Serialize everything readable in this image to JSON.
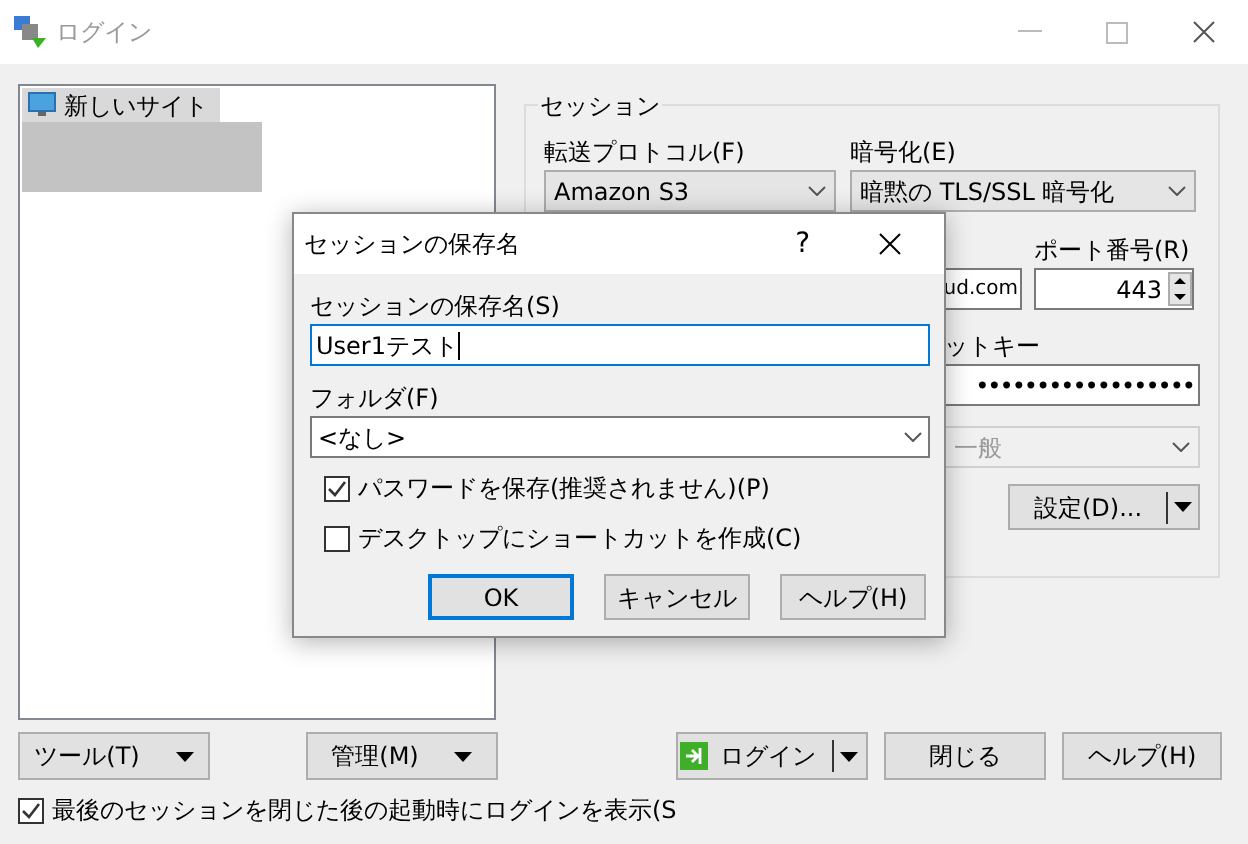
{
  "window": {
    "title": "ログイン"
  },
  "site_tree": {
    "items": [
      {
        "label": "新しいサイト",
        "selected": true
      }
    ]
  },
  "session": {
    "title": "セッション",
    "protocol": {
      "label": "転送プロトコル(F)",
      "value": "Amazon S3"
    },
    "encryption": {
      "label": "暗号化(E)",
      "value": "暗黙の TLS/SSL 暗号化"
    },
    "host": {
      "value": "ud.com"
    },
    "port": {
      "label": "ポート番号(R)",
      "value": "443"
    },
    "secret_key": {
      "label": "ットキー",
      "value": "••••••••••••••••••"
    },
    "profile": {
      "value": "一般",
      "disabled": true
    },
    "settings_button": "設定(D)..."
  },
  "bottom_buttons": {
    "tools": "ツール(T)",
    "manage": "管理(M)",
    "login": "ログイン",
    "close": "閉じる",
    "help": "ヘルプ(H)"
  },
  "show_login_checkbox": {
    "label": "最後のセッションを閉じた後の起動時にログインを表示(S",
    "checked": true
  },
  "dialog": {
    "title": "セッションの保存名",
    "help_glyph": "?",
    "name_label": "セッションの保存名(S)",
    "name_value": "User1テスト",
    "folder_label": "フォルダ(F)",
    "folder_value": "<なし>",
    "checkboxes": [
      {
        "label": "パスワードを保存(推奨されません)(P)",
        "checked": true
      },
      {
        "label": "デスクトップにショートカットを作成(C)",
        "checked": false
      }
    ],
    "buttons": [
      {
        "label": "OK",
        "default": true
      },
      {
        "label": "キャンセル",
        "default": false
      },
      {
        "label": "ヘルプ(H)",
        "default": false
      }
    ]
  }
}
